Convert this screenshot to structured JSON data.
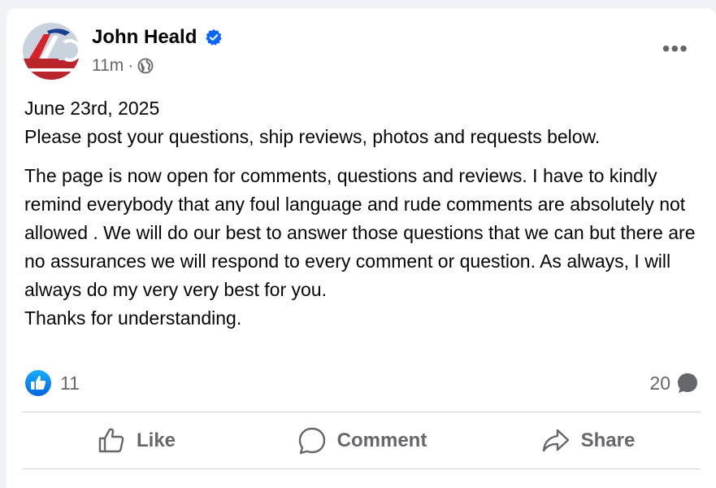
{
  "post": {
    "author": "John Heald",
    "time": "11m",
    "separator": "·",
    "text": {
      "date_line": "June 23rd, 2025",
      "intro_line": "Please post your questions, ship reviews, photos and requests below.",
      "body": "The page is now open for comments, questions and reviews. I have to kindly remind everybody that any foul language and rude comments are absolutely not allowed . We will do our best to answer those questions that we can but there are no assurances we will respond to every comment or question. As always, I will always do my very very best for you.",
      "closing": "Thanks for understanding."
    },
    "reactions": {
      "icon": "thumbs-up-icon",
      "count": "11"
    },
    "comments": {
      "count": "20",
      "icon": "comment-bubble-icon"
    },
    "actions": [
      {
        "label": "Like",
        "icon": "thumbs-up-outline-icon"
      },
      {
        "label": "Comment",
        "icon": "comment-icon"
      },
      {
        "label": "Share",
        "icon": "share-icon"
      }
    ]
  },
  "colors": {
    "facebook_blue": "#0866ff",
    "secondary_text": "#65676b",
    "primary_text": "#050505",
    "background": "#f0f2f5"
  }
}
